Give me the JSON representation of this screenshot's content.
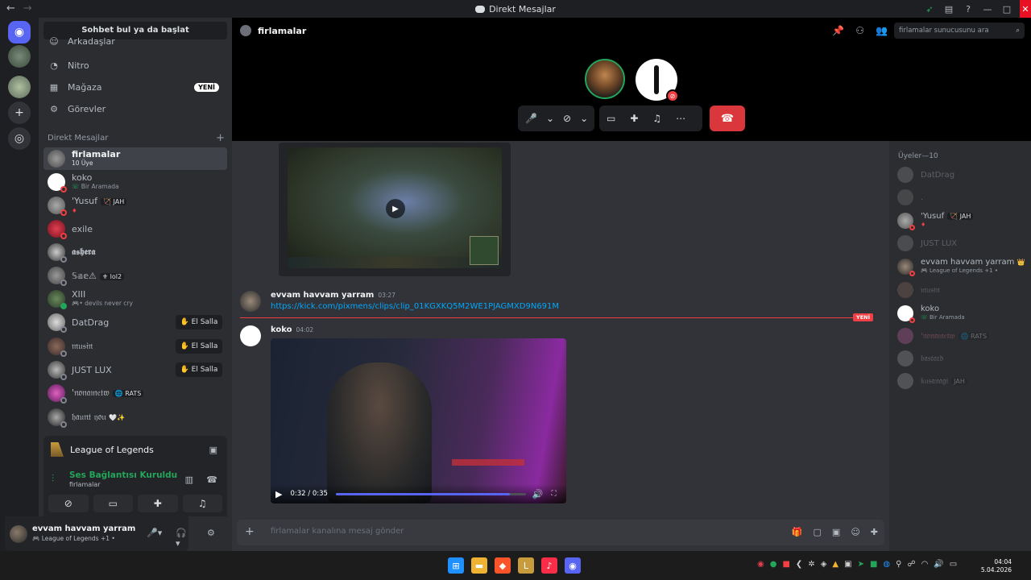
{
  "window": {
    "title": "Direkt Mesajlar",
    "back": "←",
    "forward": "→"
  },
  "sidebar": {
    "search_button": "Sohbet bul ya da başlat",
    "nav": [
      {
        "label": "Arkadaşlar",
        "icon": "friends-icon"
      },
      {
        "label": "Nitro",
        "icon": "nitro-icon"
      },
      {
        "label": "Mağaza",
        "icon": "shop-icon",
        "badge": "YENİ"
      },
      {
        "label": "Görevler",
        "icon": "quests-icon"
      }
    ],
    "dm_header": "Direkt Mesajlar",
    "dms": [
      {
        "name": "firlamalar",
        "sub": "10 Üye",
        "active": true
      },
      {
        "name": "koko",
        "sub": "Bir Aramada"
      },
      {
        "name": "ꞌYusuf",
        "tag": "🏹 JAH"
      },
      {
        "name": "exile"
      },
      {
        "name": "𝖆𝖘𝖍𝖊𝖗𝖆"
      },
      {
        "name": "𝕊𝕒𝕖⚠",
        "tag": "⚜ lol2"
      },
      {
        "name": "XIII",
        "sub": "• devils never cry"
      },
      {
        "name": "DatDrag",
        "wave": "El Salla"
      },
      {
        "name": "𝔪𝔲𝔰𝔦𝔫",
        "wave": "El Salla"
      },
      {
        "name": "JUST LUX",
        "wave": "El Salla"
      },
      {
        "name": "ꞌ𝔫𝔬𝔫𝔞𝔪𝔢𝔱𝔴",
        "tag": "🌐 RATS"
      },
      {
        "name": "𝔥𝔞𝔲𝔫𝔱 𝔶𝔬𝔲",
        "tag": "🤍✨"
      }
    ],
    "activity": {
      "name": "League of Legends"
    },
    "voice": {
      "title": "Ses Bağlantısı Kuruldu",
      "channel": "firlamalar"
    },
    "user": {
      "name": "evvam havvam yarram",
      "status": "League of Legends +1 •"
    }
  },
  "channel": {
    "name": "firlamalar",
    "search_placeholder": "firlamalar sunucusunu ara"
  },
  "messages": [
    {
      "author": "evvam havvam yarram",
      "time": "03:27",
      "link": "https://kick.com/pixmens/clips/clip_01KGXKQ5M2WE1PJAGMXD9N691M"
    },
    {
      "author": "koko",
      "time": "04:02",
      "video_time": "0:32 / 0:35",
      "progress": 0.914
    }
  ],
  "new_label": "YENİ",
  "composer": {
    "placeholder": "firlamalar kanalına mesaj gönder"
  },
  "members": {
    "header": "Üyeler—10",
    "list": [
      {
        "name": "DatDrag",
        "dim": true
      },
      {
        "name": ".",
        "dim": true
      },
      {
        "name": "ꞌYusuf",
        "tag": "🏹 JAH"
      },
      {
        "name": "JUST LUX",
        "dim": true
      },
      {
        "name": "evvam havvam yarram",
        "crown": "👑",
        "sub": "League of Legends +1 •"
      },
      {
        "name": "𝔪𝔲𝔰𝔦𝔫",
        "dim": true
      },
      {
        "name": "koko",
        "sub": "Bir Aramada"
      },
      {
        "name": "ꞌ𝔫𝔬𝔫𝔞𝔪𝔢𝔱𝔴",
        "tag": "🌐 RATS",
        "dim": true
      },
      {
        "name": "𝔟𝔞𝔰𝔱𝔞𝔯𝔡",
        "dim": true
      },
      {
        "name": "𝔨𝔲𝔰𝔞𝔫𝔞𝔤𝔦",
        "tag": "JAH",
        "dim": true
      }
    ]
  },
  "clock": {
    "time": "04:04",
    "date": "5.04.2026"
  },
  "colors": {
    "accent": "#5865f2",
    "green": "#23a55a",
    "red": "#da373c",
    "link": "#00a8fc"
  }
}
